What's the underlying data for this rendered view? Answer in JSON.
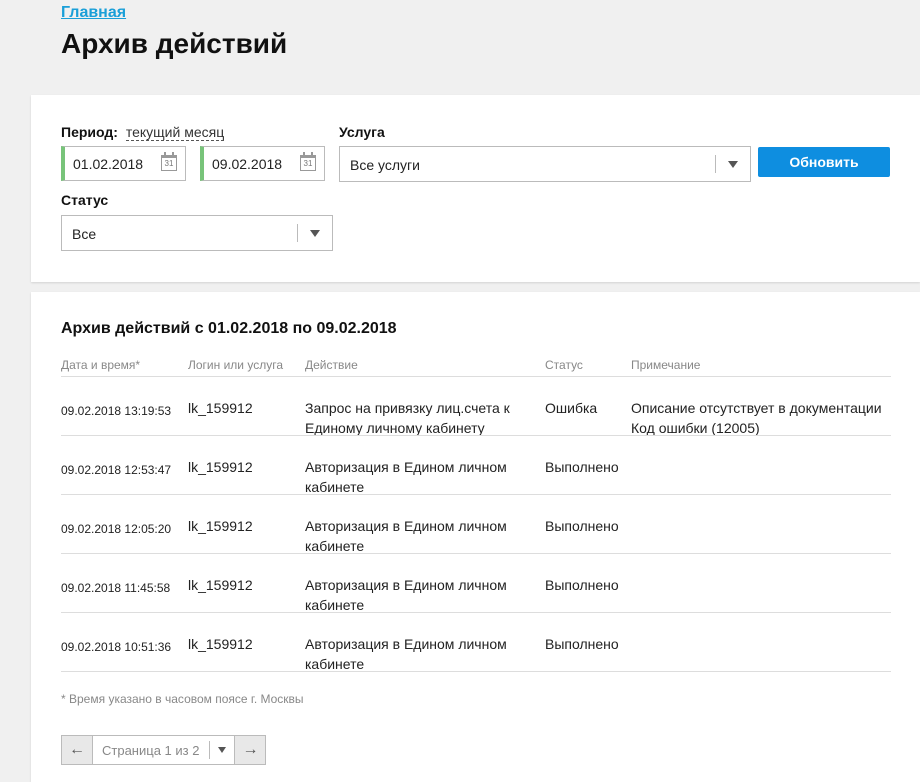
{
  "breadcrumb": "Главная",
  "page_title": "Архив действий",
  "filters": {
    "period_label": "Период:",
    "period_value": "текущий месяц",
    "date_from": "01.02.2018",
    "date_to": "09.02.2018",
    "calendar_icon_text": "31",
    "service_label": "Услуга",
    "service_value": "Все услуги",
    "status_label": "Статус",
    "status_value": "Все",
    "refresh_label": "Обновить"
  },
  "results": {
    "title": "Архив действий с 01.02.2018 по 09.02.2018",
    "columns": [
      "Дата и время*",
      "Логин или услуга",
      "Действие",
      "Статус",
      "Примечание"
    ],
    "rows": [
      {
        "datetime": "09.02.2018 13:19:53",
        "login": "lk_159912",
        "action": "Запрос на привязку лиц.счета к Единому личному кабинету",
        "status": "Ошибка",
        "note": "Описание отсутствует в документации Код ошибки (12005)"
      },
      {
        "datetime": "09.02.2018 12:53:47",
        "login": "lk_159912",
        "action": "Авторизация в Едином личном кабинете",
        "status": "Выполнено",
        "note": ""
      },
      {
        "datetime": "09.02.2018 12:05:20",
        "login": "lk_159912",
        "action": "Авторизация в Едином личном кабинете",
        "status": "Выполнено",
        "note": ""
      },
      {
        "datetime": "09.02.2018 11:45:58",
        "login": "lk_159912",
        "action": "Авторизация в Едином личном кабинете",
        "status": "Выполнено",
        "note": ""
      },
      {
        "datetime": "09.02.2018 10:51:36",
        "login": "lk_159912",
        "action": "Авторизация в Едином личном кабинете",
        "status": "Выполнено",
        "note": ""
      }
    ],
    "footnote": "* Время указано в часовом поясе г. Москвы"
  },
  "pagination": {
    "label": "Страница 1 из 2",
    "prev_icon": "arrow-left-icon",
    "next_icon": "arrow-right-icon"
  },
  "colors": {
    "link": "#1a9fd8",
    "primary_button": "#0e8ee0",
    "date_accent": "#78c47a"
  }
}
